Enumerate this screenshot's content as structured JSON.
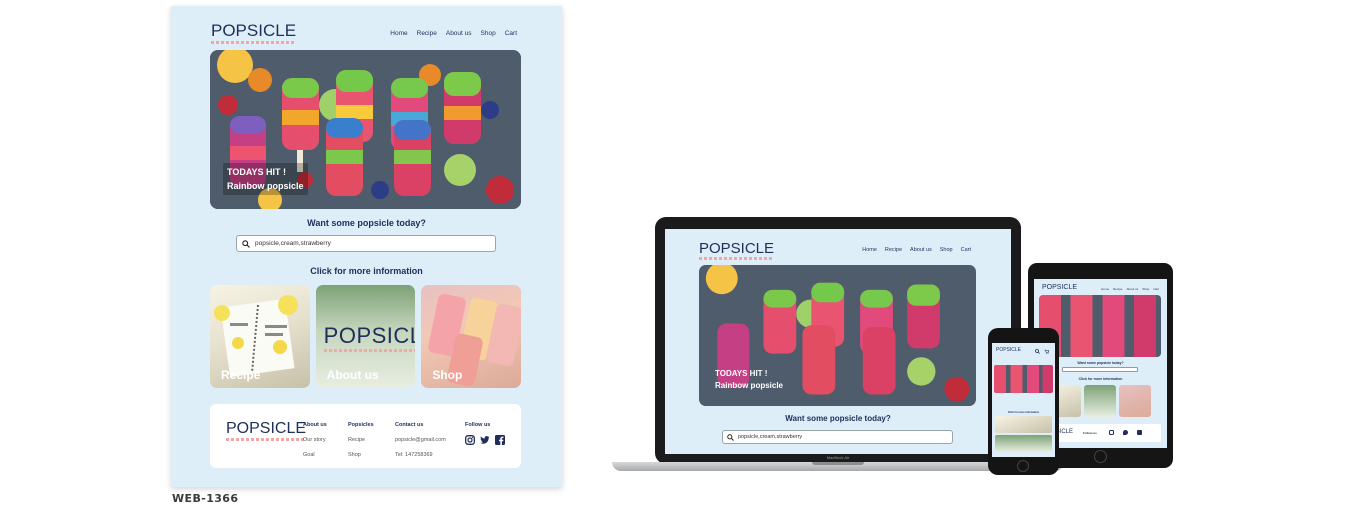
{
  "brand": {
    "logo_text": "POPSICLE"
  },
  "nav": {
    "items": [
      "Home",
      "Recipe",
      "About us",
      "Shop",
      "Cart"
    ]
  },
  "hero": {
    "line1": "TODAYS HIT !",
    "line2": "Rainbow popsicle"
  },
  "search_section": {
    "title": "Want some popsicle today?",
    "value": "popsicle,cream,strawberry"
  },
  "info_section": {
    "title": "Click for more information"
  },
  "cards": [
    {
      "label": "Recipe"
    },
    {
      "label": "About us"
    },
    {
      "label": "Shop"
    }
  ],
  "footer": {
    "columns": [
      {
        "heading": "About us",
        "items": [
          "Our story",
          "Goal"
        ]
      },
      {
        "heading": "Popsicles",
        "items": [
          "Recipe",
          "Shop"
        ]
      },
      {
        "heading": "Contact us",
        "items": [
          "popsicle@gmail.com",
          "Tel: 147258369"
        ]
      },
      {
        "heading": "Follow us",
        "items": []
      }
    ],
    "social_icons": [
      "instagram-icon",
      "twitter-icon",
      "facebook-icon"
    ]
  },
  "caption": "WEB-1366",
  "laptop": {
    "brand_label": "MacBook Air"
  },
  "tablet": {
    "search_prompt": "Want some popsicle today?",
    "info_title": "Click for more information",
    "follow_label": "Follow us"
  },
  "phone": {
    "info_title": "Click for more information"
  },
  "colors": {
    "page_bg": "#deeef8",
    "navy": "#1f2e5a",
    "logo_pink": "#f2a6a6",
    "device_black": "#151516"
  }
}
